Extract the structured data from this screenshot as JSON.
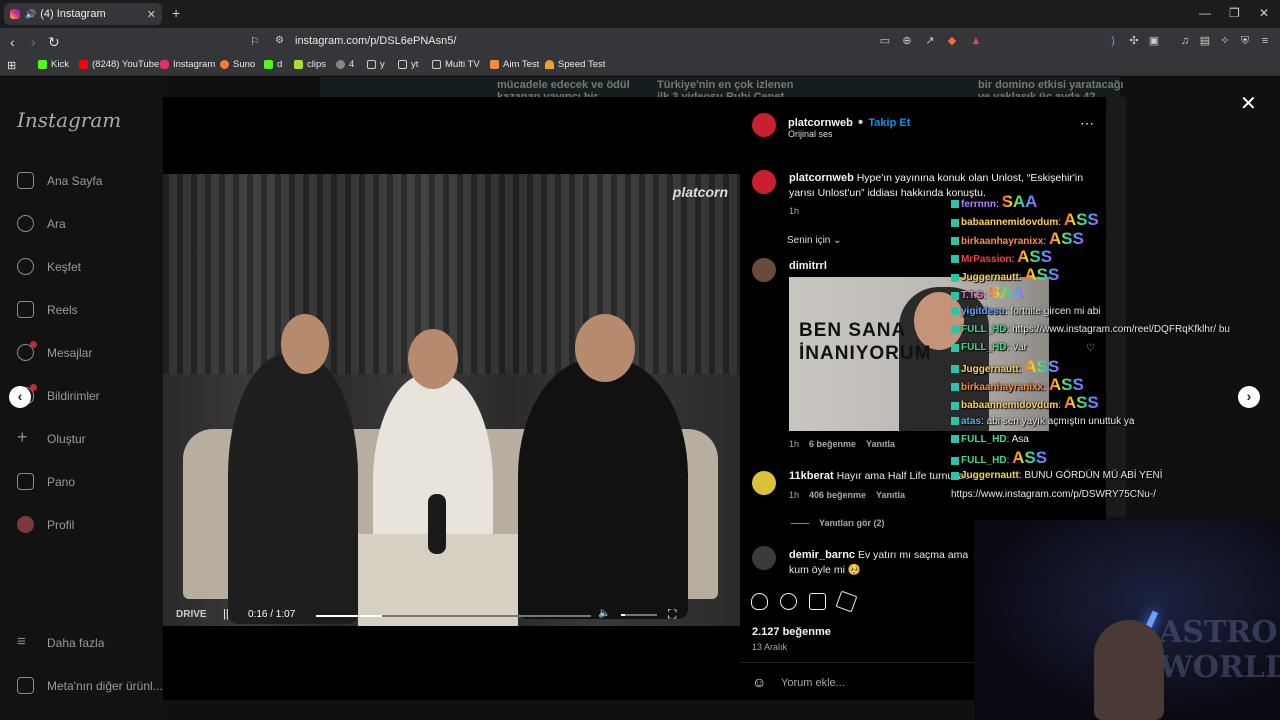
{
  "browser": {
    "tab_title": "(4) Instagram",
    "url": "instagram.com/p/DSL6ePNAsn5/",
    "bookmarks": [
      "Kick",
      "(8248) YouTube",
      "Instagram",
      "Suno",
      "d",
      "clips",
      "4",
      "y",
      "yt",
      "Multi TV",
      "Aim Test",
      "Speed Test"
    ]
  },
  "sidebar": {
    "logo": "Instagram",
    "items": [
      "Ana Sayfa",
      "Ara",
      "Keşfet",
      "Reels",
      "Mesajlar",
      "Bildirimler",
      "Oluştur",
      "Pano",
      "Profil"
    ],
    "more": "Daha fazla",
    "meta": "Meta'nın diğer ürünl..."
  },
  "background": {
    "text1a": "mücadele edecek ve ödül",
    "text1b": "kazanan yayıncı bir",
    "text2a": "Türkiye'nin en çok izlenen",
    "text2b": "ilk 3 videosu Ruhi Çenet",
    "text3a": "bir domino etkisi yaratacağı",
    "text3b": "ve yaklaşık üç ayda 42"
  },
  "video": {
    "corner_logo": "platcorn",
    "brand": "DRIVE",
    "time": "0:16 / 1:07",
    "progress": 0.24
  },
  "post": {
    "author": "platcornweb",
    "follow": "Takip Et",
    "audio": "Orijinal ses",
    "caption": "Hype'ın yayınına konuk olan Unlost, “Eskişehir'in yarısı Unlost'un” iddiası hakkında konuştu.",
    "caption_time": "1h",
    "sort": "Senin için",
    "comments": [
      {
        "user": "dimitrrl",
        "text": "",
        "gif_text": "BEN SANA İNANIYORUM",
        "time": "1h",
        "likes": "6 beğenme",
        "reply": "Yanıtla"
      },
      {
        "user": "11kberat",
        "text": "Hayır ama Half Life turnuvası...",
        "time": "1h",
        "likes": "406 beğenme",
        "reply": "Yanıtla",
        "view_replies": "Yanıtları gör (2)"
      },
      {
        "user": "demir_barnc",
        "text": "Ev yatırı mı saçma ama kum öyle mi 🥺"
      }
    ],
    "likes": "2.127 beğenme",
    "date": "13 Aralık",
    "comment_placeholder": "Yorum ekle..."
  },
  "chat": [
    {
      "user": "ferrnnn",
      "color": "#b080ff",
      "msg": "",
      "emote": "SAA"
    },
    {
      "user": "babaannemidovdum",
      "color": "#ffd24d",
      "msg": "",
      "emote": "ASS"
    },
    {
      "user": "birkaanhayranixx",
      "color": "#ff8c3a",
      "msg": "",
      "emote": "ASS"
    },
    {
      "user": "MrPassion",
      "color": "#ff3b3b",
      "msg": "",
      "emote": "ASS"
    },
    {
      "user": "Juggernautt",
      "color": "#ffd24d",
      "msg": "",
      "emote": "ASS"
    },
    {
      "user": "T.T.S",
      "color": "#ff66cc",
      "msg": "",
      "emote": "SAA"
    },
    {
      "user": "yigitdesu",
      "color": "#5aa8ff",
      "msg": "fortnite gircen mi abi",
      "emote": ""
    },
    {
      "user": "FULL_HD",
      "color": "#3ddc84",
      "msg": "https://www.instagram.com/reel/DQFRqKfklhr/ bu",
      "emote": ""
    },
    {
      "user": "FULL_HD",
      "color": "#3ddc84",
      "msg": "Var",
      "emote": ""
    },
    {
      "user": "Juggernautt",
      "color": "#ffd24d",
      "msg": "",
      "emote": "ASS"
    },
    {
      "user": "birkaanhayranixx",
      "color": "#ff8c3a",
      "msg": "",
      "emote": "ASS"
    },
    {
      "user": "babaannemidovdum",
      "color": "#ffd24d",
      "msg": "",
      "emote": "ASS"
    },
    {
      "user": "atas",
      "color": "#5aa8ff",
      "msg": "abi sen yayık açmıştın unuttuk ya",
      "emote": ""
    },
    {
      "user": "FULL_HD",
      "color": "#3ddc84",
      "msg": "Asa",
      "emote": ""
    },
    {
      "user": "FULL_HD",
      "color": "#3ddc84",
      "msg": "",
      "emote": "ASS"
    },
    {
      "user": "Juggernautt",
      "color": "#ffd24d",
      "msg": "BUNU GÖRDÜN MÜ ABİ YENİ",
      "emote": ""
    },
    {
      "user": "",
      "color": "#e8e8e8",
      "msg": "https://www.instagram.com/p/DSWRY75CNu-/",
      "emote": ""
    }
  ],
  "webcam": {
    "bg_text": "ASTRO WORLD"
  }
}
